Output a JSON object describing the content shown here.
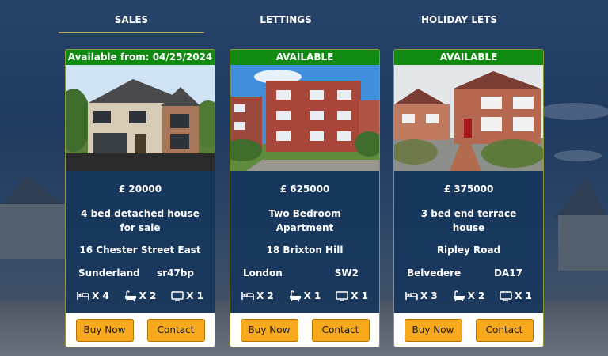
{
  "tabs": [
    {
      "label": "SALES",
      "active": true
    },
    {
      "label": "LETTINGS",
      "active": false
    },
    {
      "label": "HOLIDAY LETS",
      "active": false
    }
  ],
  "listings": [
    {
      "badge": "Available from: 04/25/2024",
      "photo": "detached-brick-house-photo",
      "price": "£ 20000",
      "title": "4 bed detached house for sale",
      "street": "16 Chester Street East",
      "city": "Sunderland",
      "postcode": "sr47bp",
      "bedrooms": "X 4",
      "bathrooms": "X 2",
      "receptions": "X 1",
      "buy_label": "Buy Now",
      "contact_label": "Contact"
    },
    {
      "badge": "AVAILABLE",
      "photo": "red-brick-apartment-block-photo",
      "price": "£ 625000",
      "title": "Two Bedroom Apartment",
      "street": "18 Brixton Hill",
      "city": "London",
      "postcode": "SW2",
      "bedrooms": "X 2",
      "bathrooms": "X 1",
      "receptions": "X 1",
      "buy_label": "Buy Now",
      "contact_label": "Contact"
    },
    {
      "badge": "AVAILABLE",
      "photo": "end-terrace-house-photo",
      "price": "£ 375000",
      "title": "3 bed end terrace house",
      "street": "Ripley Road",
      "city": "Belvedere",
      "postcode": "DA17",
      "bedrooms": "X 3",
      "bathrooms": "X 2",
      "receptions": "X 1",
      "buy_label": "Buy Now",
      "contact_label": "Contact"
    }
  ],
  "icons": {
    "bedroom": "bed-icon",
    "bathroom": "bath-icon",
    "reception": "tv-icon"
  },
  "colors": {
    "badge": "#118a12",
    "button": "#f7a81b",
    "card": "#16365c",
    "tab_underline": "#b7a55a"
  }
}
